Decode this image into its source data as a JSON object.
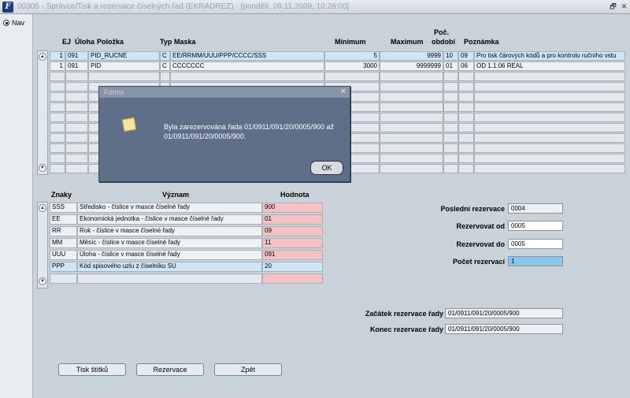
{
  "window": {
    "title": "00305 - Správce/Tisk a rezervace číselných řad (EKRADREZ) - [pondělí, 09.11.2009, 10:28:00]",
    "app_icon": "oracle-forms-icon",
    "restore_glyph": "🗗",
    "close_glyph": "✕"
  },
  "nav": {
    "label": "Nav"
  },
  "upper_table": {
    "headers": {
      "ej": "EJ",
      "uloha": "Úloha",
      "polozka": "Položka",
      "typ": "Typ",
      "maska": "Maska",
      "minimum": "Minimum",
      "maximum": "Maximum",
      "pocet_line1": "Poč.",
      "pocet_line2": "období",
      "poznamka": "Poznámka"
    },
    "rows": [
      {
        "ej": "1",
        "uloha": "091",
        "polozka": "PID_RUCNE",
        "typ": "C",
        "maska": "EE/RRMM/UUU/PPP/CCCC/SSS",
        "minimum": "5",
        "maximum": "9999",
        "p1": "10",
        "p2": "09",
        "poznamka": "Pro tisk čárových kódů a pro kontrolu ručního vstu"
      },
      {
        "ej": "1",
        "uloha": "091",
        "polozka": "PID",
        "typ": "C",
        "maska": "CCCCCCC",
        "minimum": "3000",
        "maximum": "9999999",
        "p1": "01",
        "p2": "06",
        "poznamka": "OD 1.1.06 REAL"
      }
    ]
  },
  "lower_table": {
    "headers": {
      "znaky": "Znaky",
      "vyznam": "Význam",
      "hodnota": "Hodnota"
    },
    "rows": [
      {
        "znaky": "SSS",
        "vyznam": "Středisko - číslice v masce číselné řady",
        "hodnota": "900"
      },
      {
        "znaky": "EE",
        "vyznam": "Ekonomická jednotka - číslice v masce číselné řady",
        "hodnota": "01"
      },
      {
        "znaky": "RR",
        "vyznam": "Rok - číslice v masce číselné řady",
        "hodnota": "09"
      },
      {
        "znaky": "MM",
        "vyznam": "Měsíc - číslice v masce číselné řady",
        "hodnota": "11"
      },
      {
        "znaky": "UUU",
        "vyznam": "Úloha - číslice v masce číselné řady",
        "hodnota": "091"
      },
      {
        "znaky": "PPP",
        "vyznam": "Kód spisového uzlu z číselníku SU",
        "hodnota": "20"
      }
    ]
  },
  "reservation": {
    "posledni_label": "Poslední rezervace",
    "posledni_value": "0004",
    "od_label": "Rezervovat od",
    "od_value": "0005",
    "do_label": "Rezervovat do",
    "do_value": "0005",
    "pocet_label": "Počet rezervací",
    "pocet_value": "1"
  },
  "range": {
    "zacatek_label": "Začátek rezervace řady",
    "zacatek_value": "01/0911/091/20/0005/900",
    "konec_label": "Konec rezervace řady",
    "konec_value": "01/0911/091/20/0005/900"
  },
  "buttons": {
    "tisk": "Tisk štítků",
    "rezervace": "Rezervace",
    "zpet": "Zpět"
  },
  "dialog": {
    "title": "Forms",
    "message": "Byla zarezervována řada 01/0911/091/20/0005/900 až 01/0911/091/20/0005/900.",
    "ok": "OK",
    "icon": "note-icon"
  },
  "colors": {
    "pink_field": "#f4c2c4",
    "selected_row": "#cfe4f4",
    "active_field": "#8cc4ee",
    "dialog_bg": "#5f6f8a"
  }
}
